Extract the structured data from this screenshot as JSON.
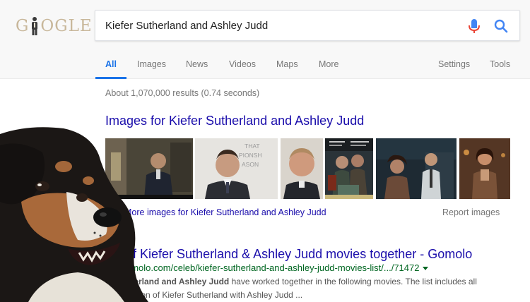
{
  "logo": {
    "text_left": "G",
    "text_right": "OGLE"
  },
  "search": {
    "query": "Kiefer Sutherland and Ashley Judd"
  },
  "nav": {
    "tabs": [
      "All",
      "Images",
      "News",
      "Videos",
      "Maps",
      "More"
    ],
    "settings": "Settings",
    "tools": "Tools"
  },
  "results": {
    "stats": "About 1,070,000 results (0.74 seconds)",
    "images_title": "Images for Kiefer Sutherland and Ashley Judd",
    "more_images": "More images for Kiefer Sutherland and Ashley Judd",
    "report_images": "Report images",
    "item": {
      "title": "of Kiefer Sutherland & Ashley Judd movies together - Gomolo",
      "url": "omolo.com/celeb/kiefer-sutherland-and-ashley-judd-movies-list/.../71472",
      "snippet_bold": "therland and Ashley Judd",
      "snippet_rest": " have worked together in the following movies. The list includes all",
      "snippet_line2": "ciation of Kiefer Sutherland with Ashley Judd ..."
    }
  },
  "thumbnails": {
    "poster_text": "THAT\nPIONSH\nASON"
  },
  "colors": {
    "link": "#1a0dab",
    "url": "#006621",
    "accent": "#1a73e8",
    "muted": "#777777"
  }
}
